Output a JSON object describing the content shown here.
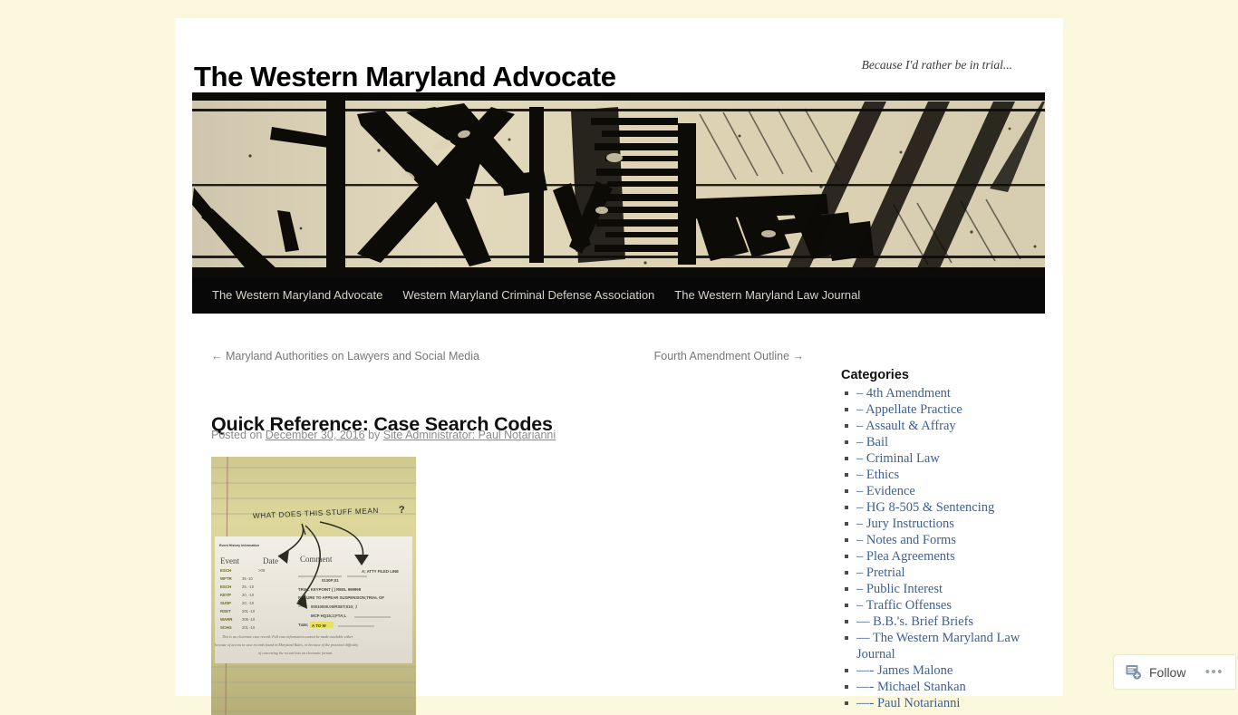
{
  "site": {
    "title": "The Western Maryland Advocate",
    "tagline": "Because I'd rather be in trial..."
  },
  "nav": {
    "items": [
      {
        "label": "The Western Maryland Advocate"
      },
      {
        "label": "Western Maryland Criminal Defense Association"
      },
      {
        "label": "The Western Maryland Law Journal"
      }
    ]
  },
  "post_nav": {
    "prev": "← Maryland Authorities on Lawyers and Social Media",
    "next": "Fourth Amendment Outline →"
  },
  "post": {
    "title": "Quick Reference: Case Search Codes",
    "meta_posted_on": "Posted on",
    "meta_date": "December 30, 2016",
    "meta_by": "by",
    "meta_author": "Site Administrator: Paul Notarianni",
    "image": {
      "handwritten_note": "WHAT DOES THIS STUFF MEAN?",
      "record_heading": "Event History Information",
      "columns": [
        "Event",
        "Date",
        "Comment"
      ],
      "rows": [
        {
          "event": "ESCH",
          "date": ">09"
        },
        {
          "event": "WFTR",
          "date": "36     -10"
        },
        {
          "event": "ESCH",
          "date": "25.     -10"
        },
        {
          "event": "KEYP",
          "date": "20.     -10"
        },
        {
          "event": "SUSP",
          "date": "20.     -10"
        },
        {
          "event": "RSET",
          "date": "201     -10"
        },
        {
          "event": "WARR",
          "date": "206     -10"
        },
        {
          "event": "SCHG",
          "date": "201     -10"
        }
      ],
      "comment_lines": [
        "A; ATTY FILED LINE",
        "0130P;01",
        "TRIAL KEYPOINT (        ) REEL 999998",
        "FAILURE TO APPEAR SUSPENSION;TRIAL OF",
        "00010000.00/RSET;010; ;/",
        "MCP HQ15;2;FTA;L",
        "T446;A TO W"
      ],
      "disclaimer": "This is an electronic case record. Full case information cannot be made available either because of access to case records found in Maryland Rules, or because of the practical difficulty of converting the record into an electronic format."
    }
  },
  "sidebar": {
    "categories_heading": "Categories",
    "categories": [
      {
        "label": "– 4th Amendment"
      },
      {
        "label": "– Appellate Practice"
      },
      {
        "label": "– Assault & Affray"
      },
      {
        "label": "– Bail"
      },
      {
        "label": "– Criminal Law"
      },
      {
        "label": "– Ethics"
      },
      {
        "label": "– Evidence"
      },
      {
        "label": "– HG 8-505 & Sentencing"
      },
      {
        "label": "– Jury Instructions"
      },
      {
        "label": "– Notes and Forms"
      },
      {
        "label": "– Plea Agreements"
      },
      {
        "label": "– Pretrial"
      },
      {
        "label": "– Public Interest"
      },
      {
        "label": "– Traffic Offenses"
      },
      {
        "label": "— B.B.'s. Brief Briefs"
      },
      {
        "label": "— The Western Maryland Law Journal"
      },
      {
        "label": "—- James Malone"
      },
      {
        "label": "—- Michael Stankan"
      },
      {
        "label": "—- Paul Notarianni"
      }
    ]
  },
  "follow_bar": {
    "label": "Follow",
    "more": "•••"
  },
  "colors": {
    "page_background": "#fbf8dd",
    "content_background": "#ffffff",
    "nav_background": "#080808",
    "nav_text": "#d9d4c9",
    "link_blue": "#3c6099",
    "banner_tan": "#d8ceb4",
    "banner_ink": "#0d0b07",
    "muted_text": "#8a8a8a"
  }
}
